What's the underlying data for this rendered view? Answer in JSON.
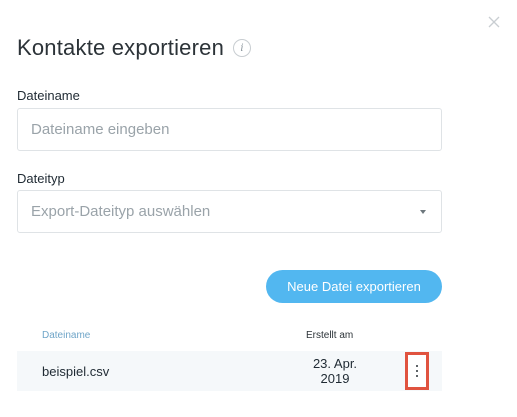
{
  "dialog": {
    "title": "Kontakte exportieren",
    "info_icon": "info-icon",
    "close_icon": "close-icon"
  },
  "form": {
    "filename_label": "Dateiname",
    "filename_placeholder": "Dateiname eingeben",
    "filename_value": "",
    "filetype_label": "Dateityp",
    "filetype_placeholder": "Export-Dateityp auswählen"
  },
  "actions": {
    "export_label": "Neue Datei exportieren"
  },
  "table": {
    "columns": [
      "Dateiname",
      "Erstellt am"
    ],
    "rows": [
      {
        "name": "beispiel.csv",
        "date": "23. Apr. 2019",
        "menu_icon": "more-vertical-icon"
      }
    ]
  },
  "colors": {
    "accent": "#52b7f0",
    "highlight_border": "#e0533f",
    "row_background": "#f5f8fa"
  }
}
